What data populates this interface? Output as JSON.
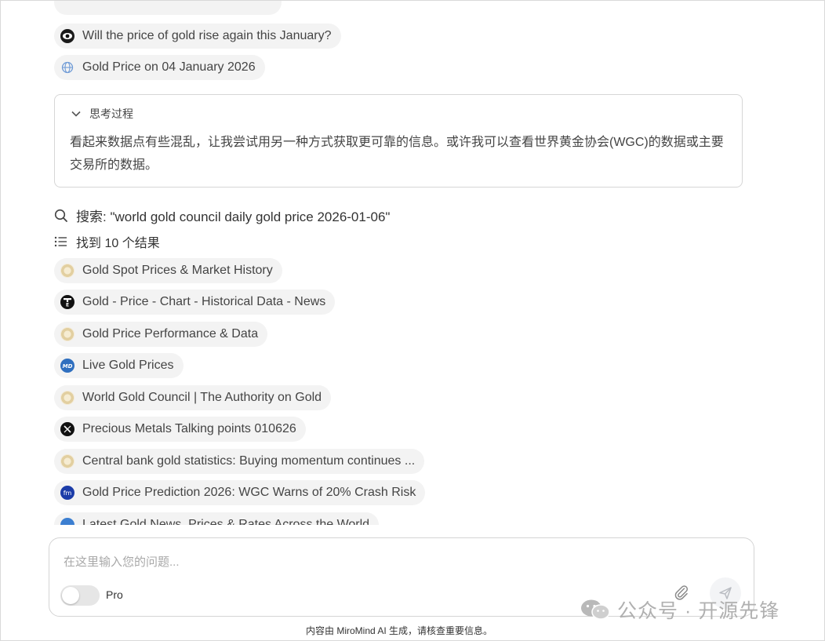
{
  "results_top": [
    {
      "label": "Will the price of gold rise again this January?",
      "icon": "eye-icon"
    },
    {
      "label": "Gold Price on 04 January 2026",
      "icon": "globe-icon"
    }
  ],
  "thinking": {
    "header": "思考过程",
    "text": "看起来数据点有些混乱，让我尝试用另一种方式获取更可靠的信息。或许我可以查看世界黄金协会(WGC)的数据或主要交易所的数据。"
  },
  "search": {
    "query_label": "搜索: \"world gold council daily gold price 2026-01-06\"",
    "found_label": "找到 10 个结果"
  },
  "results": [
    {
      "label": "Gold Spot Prices & Market History",
      "icon": "gold-coin-icon"
    },
    {
      "label": "Gold - Price - Chart - Historical Data - News",
      "icon": "trading-economics-icon"
    },
    {
      "label": "Gold Price Performance & Data",
      "icon": "gold-coin-icon"
    },
    {
      "label": "Live Gold Prices",
      "icon": "md-logo-icon"
    },
    {
      "label": "World Gold Council | The Authority on Gold",
      "icon": "gold-coin-icon"
    },
    {
      "label": "Precious Metals Talking points 010626",
      "icon": "x-logo-icon"
    },
    {
      "label": "Central bank gold statistics: Buying momentum continues ...",
      "icon": "gold-coin-icon"
    },
    {
      "label": "Gold Price Prediction 2026: WGC Warns of 20% Crash Risk",
      "icon": "fm-logo-icon"
    },
    {
      "label": "Latest Gold News, Prices & Rates Across the World",
      "icon": "blue-circle-icon"
    }
  ],
  "composer": {
    "placeholder": "在这里输入您的问题...",
    "pro_label": "Pro"
  },
  "watermark": "公众号 · 开源先锋",
  "disclaimer": "内容由 MiroMind AI 生成，请核查重要信息。"
}
